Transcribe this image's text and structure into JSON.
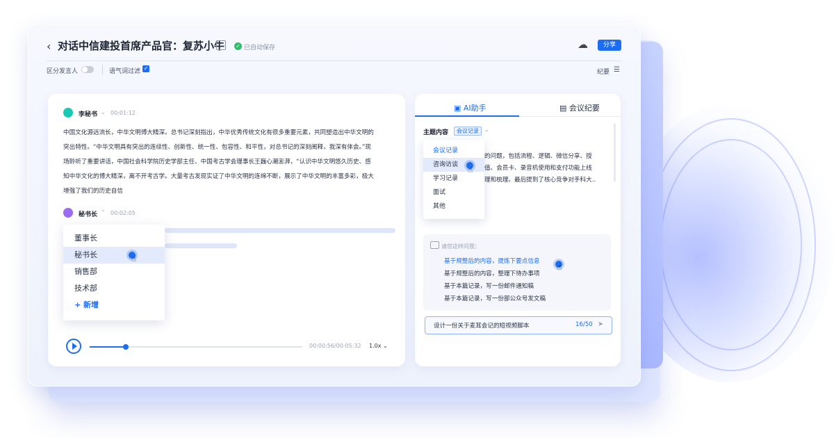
{
  "header": {
    "title": "对话中信建投首席产品官：复苏小牛",
    "saved_text": "已自动保存",
    "share_label": "分享"
  },
  "toolbar": {
    "speaker_toggle_label": "区分发言人",
    "filler_filter_label": "语气词过滤",
    "summary_label": "纪要"
  },
  "transcript": {
    "speaker1": {
      "name": "李秘书",
      "time": "00:01:12"
    },
    "paragraph1_line1": "中国文化源远流长，中华文明博大精深。总书记深刻指出，中华优秀传统文化有很多重要元素，共同塑造出中华文明的",
    "paragraph1_line2": "突出特性。“中华文明具有突出的连续性、创新性、统一性、包容性、和平性，对总书记的深刻阐释，我深有体会。”现",
    "paragraph1_line3": "场聆听了重要讲话，中国社会科学院历史学部主任、中国考古学会理事长王巍心潮澎湃，“认识中华文明悠久历史、感",
    "paragraph1_line4": "知中华文化的博大精深，离不开考古学。大量考古发现实证了中华文明的连绵不断，展示了中华文明的丰富多彩，极大",
    "paragraph1_line5": "增强了我们的历史自信",
    "speaker2": {
      "name": "秘书长",
      "time": "00:02:05"
    }
  },
  "speaker_dropdown": {
    "items": [
      "董事长",
      "秘书长",
      "销售部",
      "技术部"
    ],
    "add_label": "+ 新增"
  },
  "player": {
    "time": "00:00:56/00:05:32",
    "speed": "1.0x",
    "progress": 0.17
  },
  "right_panel": {
    "tab_ai": "AI助手",
    "tab_minutes": "会议纪要",
    "topic_label": "主题内容",
    "topic_tag": "会议记录",
    "summary_line1": "的问题，包括流程、逻辑、微信分享、授",
    "summary_line2": "值、会员卡、录音机使用和支付功能上线",
    "summary_line3": "理和梳理。最后提到了核心竞争对手科大..",
    "topic_options": [
      "会议记录",
      "咨询访谈",
      "学习记录",
      "面试",
      "其他"
    ],
    "suggest_title": "请您这样问我：",
    "suggestions": [
      "基于规整后的内容，提炼下要点信息",
      "基于规整后的内容，整理下待办事项",
      "基于本篇记录，写一份邮件通知稿",
      "基于本篇记录，写一份部公众号发文稿"
    ],
    "input_text": "设计一份关于麦耳会记的短视频脚本",
    "input_count": "16/50"
  },
  "colors": {
    "accent": "#1c6df0",
    "avatar1": "#19c9b4",
    "avatar2": "#9a6cf0",
    "saved": "#2fbf6a"
  }
}
